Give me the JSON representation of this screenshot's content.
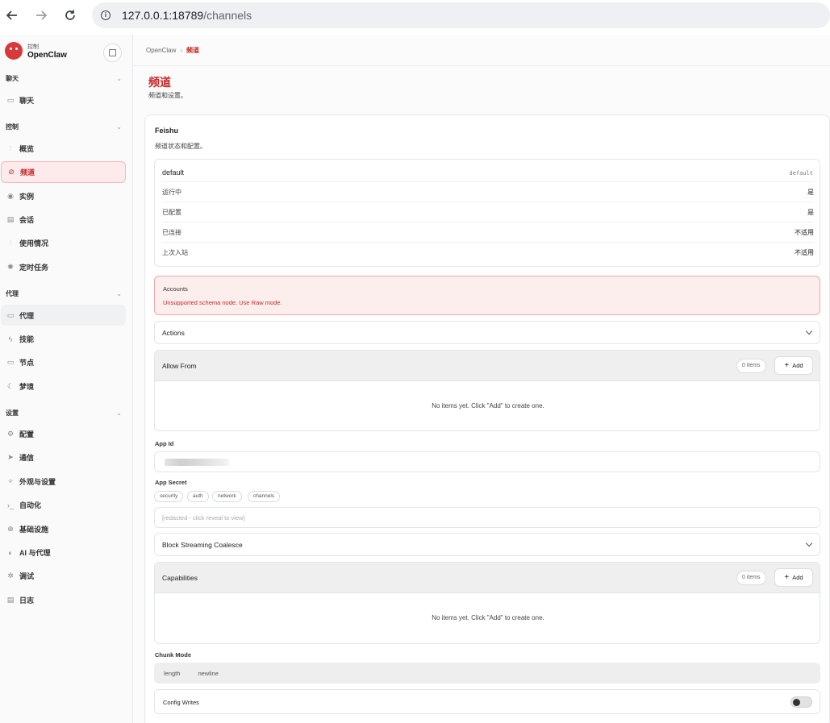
{
  "browser": {
    "url_host": "127.0.0.1:18789",
    "url_path": "/channels",
    "back_icon": "arrow-left-icon",
    "forward_icon": "arrow-right-icon",
    "reload_icon": "reload-icon"
  },
  "brand": {
    "sub": "控制",
    "name": "OpenClaw"
  },
  "sidebar": {
    "groups": {
      "chat": "聊天",
      "control": "控制",
      "agent": "代理",
      "settings": "设置"
    },
    "items": {
      "chat": "聊天",
      "overview": "概览",
      "channels": "频道",
      "instances": "实例",
      "sessions": "会话",
      "usage": "使用情况",
      "cron": "定时任务",
      "agents": "代理",
      "skills": "技能",
      "nodes": "节点",
      "dreams": "梦境",
      "config": "配置",
      "communication": "通信",
      "appearance": "外观与设置",
      "automation": "自动化",
      "infrastructure": "基础设施",
      "ai_agents": "AI 与代理",
      "debug": "调试",
      "logs": "日志"
    }
  },
  "breadcrumb": {
    "root": "OpenClaw",
    "sep": "›",
    "current": "频道"
  },
  "page": {
    "title": "频道",
    "subtitle": "频道和设置。"
  },
  "card": {
    "title": "Feishu",
    "subtitle": "频道状态和配置。",
    "status": {
      "name": "default",
      "id": "default",
      "rows": [
        {
          "k": "运行中",
          "v": "是"
        },
        {
          "k": "已配置",
          "v": "是"
        },
        {
          "k": "已连接",
          "v": "不适用"
        },
        {
          "k": "上次入站",
          "v": "不适用"
        }
      ]
    },
    "accounts": {
      "title": "Accounts",
      "error": "Unsupported schema node. Use Raw mode."
    },
    "actions_label": "Actions",
    "allow_from": {
      "title": "Allow From",
      "count": "0 items",
      "add": "Add",
      "empty": "No items yet. Click \"Add\" to create one."
    },
    "app_id_label": "App Id",
    "app_secret": {
      "label": "App Secret",
      "tags": [
        "security",
        "auth",
        "network",
        "channels"
      ],
      "placeholder": "[redacted - click reveal to view]"
    },
    "block_streaming_label": "Block Streaming Coalesce",
    "capabilities": {
      "title": "Capabilities",
      "count": "0 items",
      "add": "Add",
      "empty": "No items yet. Click \"Add\" to create one."
    },
    "chunk_mode": {
      "label": "Chunk Mode",
      "options": [
        "length",
        "newline"
      ]
    },
    "config_writes": {
      "label": "Config Writes",
      "enabled": false
    }
  }
}
